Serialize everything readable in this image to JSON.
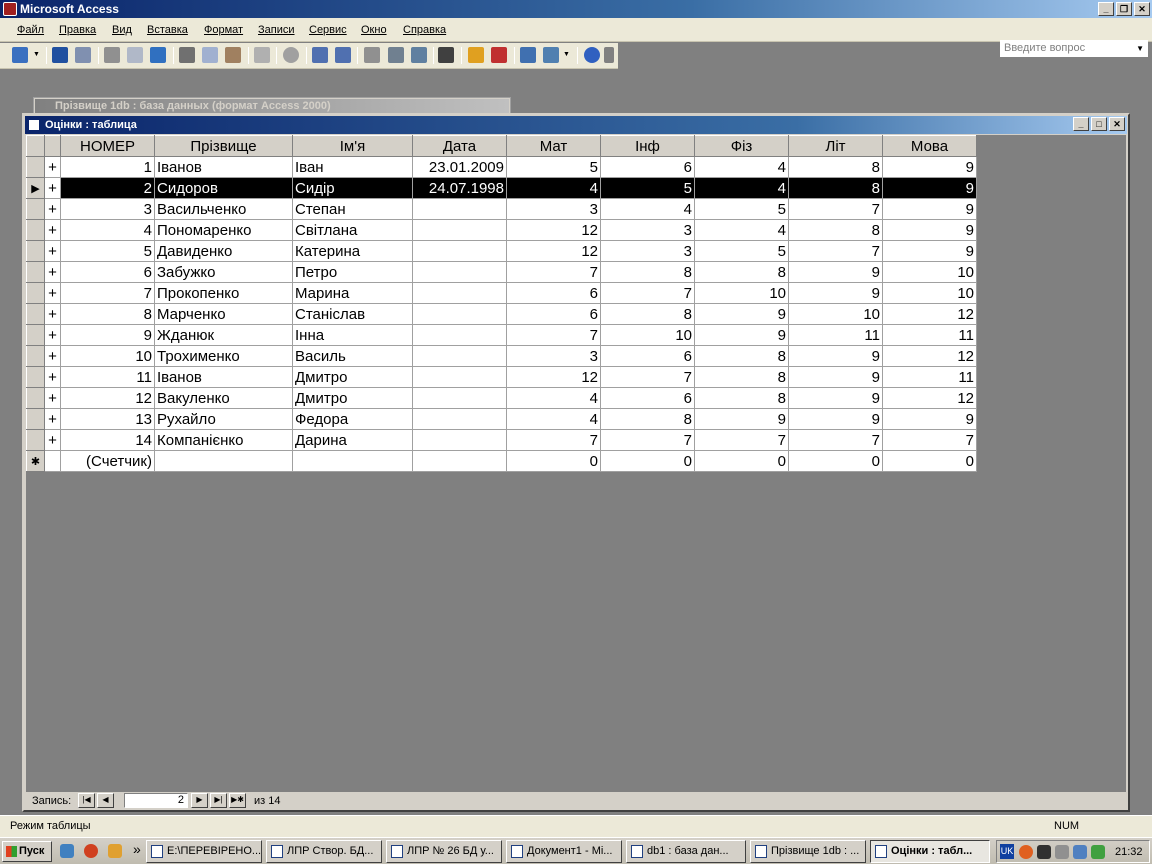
{
  "app": {
    "title": "Microsoft Access"
  },
  "menu": [
    "Файл",
    "Правка",
    "Вид",
    "Вставка",
    "Формат",
    "Записи",
    "Сервис",
    "Окно",
    "Справка"
  ],
  "help_box": {
    "placeholder": "Введите вопрос"
  },
  "toolbar_icons": [
    "view-icon",
    "save-icon",
    "file-search-icon",
    "print-icon",
    "print-preview-icon",
    "spelling-icon",
    "cut-icon",
    "copy-icon",
    "paste-icon",
    "undo-icon",
    "hyperlink-icon",
    "sort-asc-icon",
    "sort-desc-icon",
    "filter-by-selection-icon",
    "filter-by-form-icon",
    "apply-filter-icon",
    "find-icon",
    "new-record-icon",
    "delete-record-icon",
    "database-window-icon",
    "new-object-icon",
    "help-icon"
  ],
  "bg_window": {
    "title": "Прізвище 1db : база данных (формат Access 2000)"
  },
  "table_window": {
    "title": "Оцінки : таблица",
    "columns": [
      "НОМЕР",
      "Прізвище",
      "Ім'я",
      "Дата",
      "Мат",
      "Інф",
      "Фіз",
      "Літ",
      "Мова"
    ],
    "rows": [
      [
        "1",
        "Іванов",
        "Іван",
        "23.01.2009",
        "5",
        "6",
        "4",
        "8",
        "9"
      ],
      [
        "2",
        "Сидоров",
        "Сидір",
        "24.07.1998",
        "4",
        "5",
        "4",
        "8",
        "9"
      ],
      [
        "3",
        "Васильченко",
        "Степан",
        "",
        "3",
        "4",
        "5",
        "7",
        "9"
      ],
      [
        "4",
        "Пономаренко",
        "Світлана",
        "",
        "12",
        "3",
        "4",
        "8",
        "9"
      ],
      [
        "5",
        "Давиденко",
        "Катерина",
        "",
        "12",
        "3",
        "5",
        "7",
        "9"
      ],
      [
        "6",
        "Забужко",
        "Петро",
        "",
        "7",
        "8",
        "8",
        "9",
        "10"
      ],
      [
        "7",
        "Прокопенко",
        "Марина",
        "",
        "6",
        "7",
        "10",
        "9",
        "10"
      ],
      [
        "8",
        "Марченко",
        "Станіслав",
        "",
        "6",
        "8",
        "9",
        "10",
        "12"
      ],
      [
        "9",
        "Жданюк",
        "Інна",
        "",
        "7",
        "10",
        "9",
        "11",
        "11"
      ],
      [
        "10",
        "Трохименко",
        "Василь",
        "",
        "3",
        "6",
        "8",
        "9",
        "12"
      ],
      [
        "11",
        "Іванов",
        "Дмитро",
        "",
        "12",
        "7",
        "8",
        "9",
        "11"
      ],
      [
        "12",
        "Вакуленко",
        "Дмитро",
        "",
        "4",
        "6",
        "8",
        "9",
        "12"
      ],
      [
        "13",
        "Рухайло",
        "Федора",
        "",
        "4",
        "8",
        "9",
        "9",
        "9"
      ],
      [
        "14",
        "Компанієнко",
        "Дарина",
        "",
        "7",
        "7",
        "7",
        "7",
        "7"
      ]
    ],
    "new_row": [
      "(Счетчик)",
      "",
      "",
      "",
      "0",
      "0",
      "0",
      "0",
      "0"
    ],
    "current_row_index": 1,
    "expand_symbol": "+",
    "new_row_marker": "✱",
    "current_marker": "▶"
  },
  "record_nav": {
    "label": "Запись:",
    "current": "2",
    "of_text": "из  14"
  },
  "status": {
    "mode": "Режим таблицы",
    "num": "NUM"
  },
  "taskbar": {
    "start": "Пуск",
    "more": "»",
    "tasks": [
      "E:\\ПЕРЕВІРЕНО...",
      "ЛПР Створ. БД...",
      "ЛПР № 26 БД у...",
      "Документ1 - Mi...",
      "db1 : база дан...",
      "Прізвище 1db : ...",
      "Оцінки : табл..."
    ],
    "lang": "UK",
    "clock": "21:32"
  }
}
